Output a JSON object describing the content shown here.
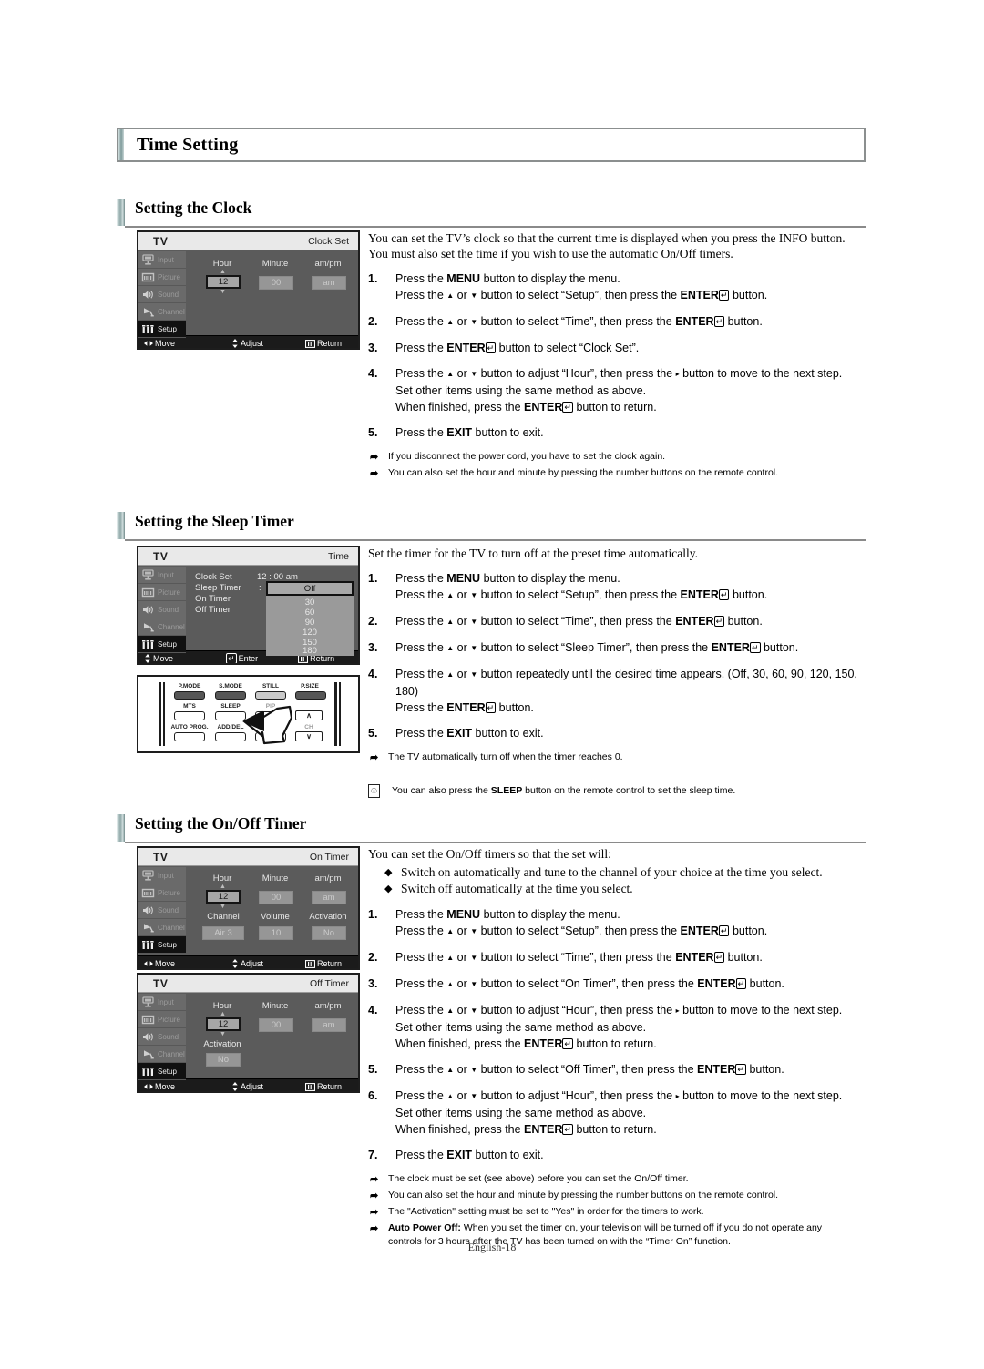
{
  "page": {
    "title": "Time Setting",
    "footer": "English-18"
  },
  "sections": [
    {
      "heading": "Setting the Clock",
      "lead1": "You can set the TV’s clock so that the current time is displayed when you press the INFO button.",
      "lead2": "You must also set the time if you wish to use the automatic On/Off timers.",
      "steps": [
        {
          "num": "1.",
          "line1_a": "Press the ",
          "line1_b": "MENU",
          "line1_c": " button to display the menu.",
          "line2": "Press the ▲ or ▼ button to select “Setup”, then press the ENTER button."
        },
        {
          "num": "2.",
          "line1": "Press the ▲ or ▼ button to select “Time”, then press the ENTER button."
        },
        {
          "num": "3.",
          "line1": "Press the ENTER button to select “Clock Set”."
        },
        {
          "num": "4.",
          "line1": "Press the ▲ or ▼ button to adjust “Hour”, then press the ▸ button to move to the next step.",
          "line2": "Set other items using the same method as above.",
          "line3": "When finished, press the ENTER button to return."
        },
        {
          "num": "5.",
          "line1": "Press the EXIT button to exit."
        }
      ],
      "notes": [
        "If you disconnect the power cord, you have to set the clock again.",
        "You can also set the hour and minute by pressing the number buttons on the remote control."
      ]
    },
    {
      "heading": "Setting the Sleep Timer",
      "lead1": "Set the timer for the TV to turn off at the preset time automatically.",
      "steps": [
        {
          "num": "1."
        },
        {
          "num": "2."
        },
        {
          "num": "3."
        },
        {
          "num": "4."
        },
        {
          "num": "5."
        }
      ],
      "notes": [
        "The TV automatically turn off when the timer reaches 0."
      ],
      "tip": "You can also press the SLEEP button on the remote control to set the sleep time."
    },
    {
      "heading": "Setting the On/Off Timer",
      "lead1": "You can set the On/Off timers so that the set will:",
      "bullets": [
        "Switch on automatically and tune to the channel of your choice at the time you select.",
        "Switch off automatically at the time you select."
      ],
      "notes": [
        "The clock must be set (see above) before you can set the On/Off timer.",
        "You can also set the hour and minute by pressing the number buttons on the remote control.",
        "The \"Activation\" setting must be set to \"Yes\" in order for the timers to work."
      ],
      "autopower_label": "Auto Power Off:",
      "autopower_line1": " When you set the timer on, your television will be turned off if you do not operate any",
      "autopower_line2": "controls for 3 hours after the TV has been turned on with the “Timer On” function."
    }
  ],
  "osd_common": {
    "tv_logo": "TV",
    "sidebar": [
      {
        "label": "Input",
        "icon": "input-icon",
        "active": false
      },
      {
        "label": "Picture",
        "icon": "picture-icon",
        "active": false
      },
      {
        "label": "Sound",
        "icon": "sound-icon",
        "active": false
      },
      {
        "label": "Channel",
        "icon": "channel-icon",
        "active": false
      },
      {
        "label": "Setup",
        "icon": "setup-icon",
        "active": true
      }
    ],
    "bottom_move": "Move",
    "bottom_adjust": "Adjust",
    "bottom_enter": "Enter",
    "bottom_return": "Return"
  },
  "osd_clock": {
    "title": "Clock Set",
    "labels": {
      "hour": "Hour",
      "minute": "Minute",
      "ampm": "am/pm"
    },
    "values": {
      "hour": "12",
      "minute": "00",
      "ampm": "am"
    }
  },
  "osd_time": {
    "title": "Time",
    "rows": [
      {
        "label": "Clock Set",
        "value": "12 : 00    am"
      },
      {
        "label": "Sleep Timer",
        "value": ":"
      },
      {
        "label": "On Timer",
        "value": ""
      },
      {
        "label": "Off Timer",
        "value": ""
      }
    ],
    "sleep_options": [
      "Off",
      "30",
      "60",
      "90",
      "120",
      "150",
      "180"
    ],
    "sleep_selected": "Off"
  },
  "osd_on_timer": {
    "title": "On Timer",
    "labels": {
      "hour": "Hour",
      "minute": "Minute",
      "ampm": "am/pm",
      "channel": "Channel",
      "volume": "Volume",
      "activation": "Activation"
    },
    "values": {
      "hour": "12",
      "minute": "00",
      "ampm": "am",
      "channel": "Air   3",
      "volume": "10",
      "activation": "No"
    }
  },
  "osd_off_timer": {
    "title": "Off Timer",
    "labels": {
      "hour": "Hour",
      "minute": "Minute",
      "ampm": "am/pm",
      "activation": "Activation"
    },
    "values": {
      "hour": "12",
      "minute": "00",
      "ampm": "am",
      "activation": "No"
    }
  },
  "remote": {
    "buttons": [
      {
        "label": "P.MODE",
        "style": "dark"
      },
      {
        "label": "S.MODE",
        "style": "dark"
      },
      {
        "label": "STILL",
        "style": "light"
      },
      {
        "label": "P.SIZE",
        "style": "dark"
      },
      {
        "label": "MTS",
        "style": "plain"
      },
      {
        "label": "SLEEP",
        "style": "plain"
      },
      {
        "label": "PIP",
        "style": "plain-grey"
      },
      {
        "label": "AUTO PROG.",
        "style": "plain"
      },
      {
        "label": "ADD/DEL",
        "style": "plain"
      },
      {
        "label": "CH",
        "style": "label-grey"
      }
    ],
    "ch_up": "∧",
    "ch_down": "∨"
  },
  "colors": {
    "osd_bg": "#5b5b5b",
    "osd_sidebar": "#6a6a6a",
    "osd_active": "#111111",
    "accent_rule": "#8a8a8a"
  }
}
